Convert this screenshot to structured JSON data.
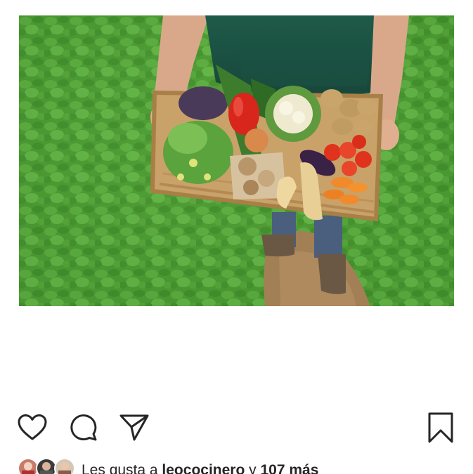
{
  "post": {
    "image_description_icon": "vegetable-basket-photo",
    "actions": {
      "like_icon": "heart-icon",
      "comment_icon": "comment-icon",
      "share_icon": "paper-plane-icon",
      "save_icon": "bookmark-icon"
    },
    "likes": {
      "prefix": "Les gusta a ",
      "user": "leococinero",
      "connector": " y ",
      "count": "107 más"
    }
  },
  "colors": {
    "icon": "#262626",
    "text": "#262626",
    "background": "#ffffff"
  }
}
